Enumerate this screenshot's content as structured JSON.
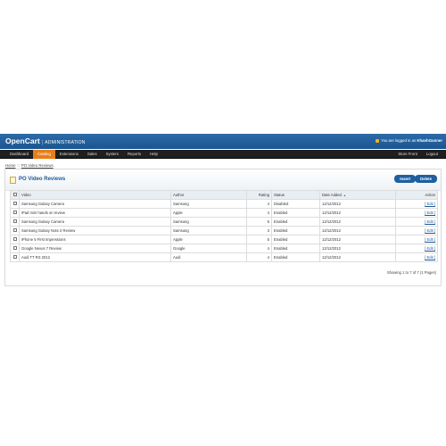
{
  "header": {
    "brand": "OpenCart",
    "separator": "|",
    "admin_label": "ADMINISTRATION",
    "login_prefix": "You are logged in as",
    "login_user": "KhanhGunner"
  },
  "menu": {
    "items": [
      "Dashboard",
      "Catalog",
      "Extensions",
      "Sales",
      "System",
      "Reports",
      "Help"
    ],
    "active_index": 1,
    "right_items": [
      "Store Front",
      "Logout"
    ]
  },
  "breadcrumb": [
    "Home",
    "PO Video Reviews"
  ],
  "breadcrumb_separator": "::",
  "panel": {
    "title": "PO Video Reviews",
    "insert_label": "Insert",
    "delete_label": "Delete"
  },
  "table": {
    "headers": {
      "video": "Video",
      "author": "Author",
      "rating": "Rating",
      "status": "Status",
      "date_added": "Date Added",
      "action": "Action"
    },
    "rows": [
      {
        "video": "Samsung Galaxy Camera",
        "author": "Samsung",
        "rating": "4",
        "status": "Disabled",
        "date_added": "12/12/2012",
        "action": "[ Edit ]"
      },
      {
        "video": "iPad mini hands on review",
        "author": "Apple",
        "rating": "4",
        "status": "Enabled",
        "date_added": "12/12/2012",
        "action": "[ Edit ]"
      },
      {
        "video": "Samsung Galaxy Camera",
        "author": "Samsung",
        "rating": "5",
        "status": "Enabled",
        "date_added": "12/12/2012",
        "action": "[ Edit ]"
      },
      {
        "video": "Samsung Galaxy Note 2 Review",
        "author": "Samsung",
        "rating": "3",
        "status": "Enabled",
        "date_added": "12/12/2012",
        "action": "[ Edit ]"
      },
      {
        "video": "iPhone 5 First Impressions",
        "author": "Apple",
        "rating": "5",
        "status": "Enabled",
        "date_added": "12/12/2012",
        "action": "[ Edit ]"
      },
      {
        "video": "Google Nexus 7 Review",
        "author": "Google",
        "rating": "4",
        "status": "Enabled",
        "date_added": "12/12/2012",
        "action": "[ Edit ]"
      },
      {
        "video": "Audi TT RS 2012",
        "author": "Audi",
        "rating": "4",
        "status": "Enabled",
        "date_added": "12/12/2012",
        "action": "[ Edit ]"
      }
    ]
  },
  "pagination_text": "Showing 1 to 7 of 7 (1 Pages)",
  "colors": {
    "header_blue": "#1c5590",
    "menu_dark": "#1f1f1f",
    "menu_active": "#e67e19",
    "link_blue": "#1b5a97",
    "button_blue": "#1f5fa0"
  }
}
